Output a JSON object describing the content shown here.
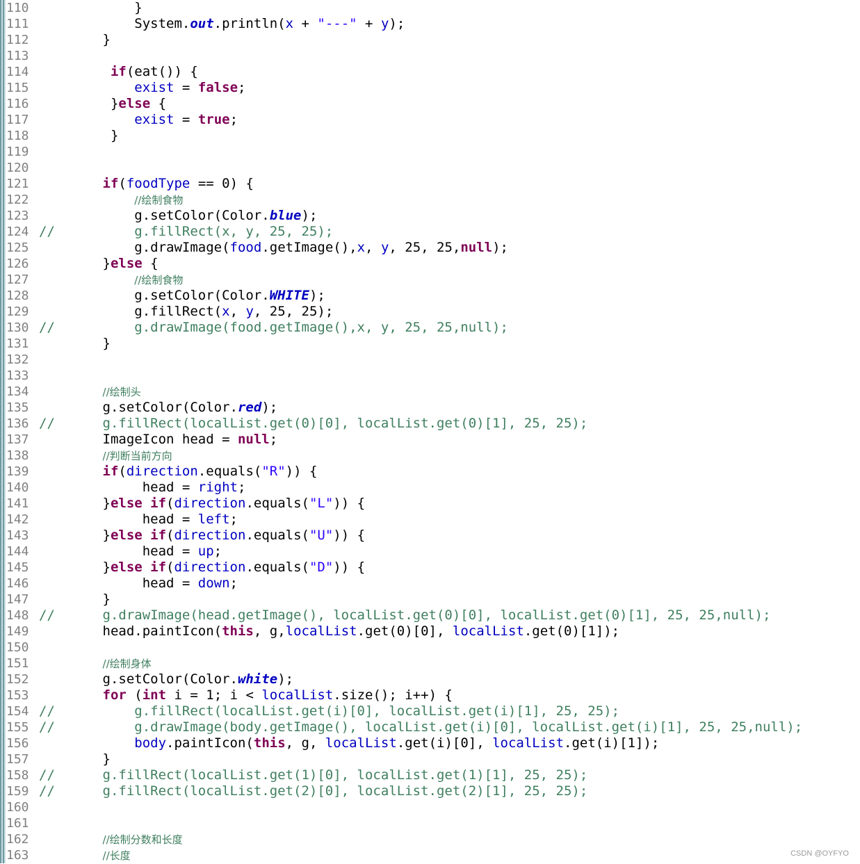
{
  "editor": {
    "colors": {
      "keyword": "#7f0055",
      "field": "#0000c0",
      "string": "#2a00ff",
      "comment": "#3f7f5f",
      "plain": "#000000",
      "line_number": "#808080"
    },
    "lines": [
      {
        "num": "110",
        "tokens": [
          {
            "t": "            }",
            "c": "plain"
          }
        ]
      },
      {
        "num": "111",
        "tokens": [
          {
            "t": "            System.",
            "c": "plain"
          },
          {
            "t": "out",
            "c": "sfield"
          },
          {
            "t": ".println(",
            "c": "plain"
          },
          {
            "t": "x",
            "c": "field"
          },
          {
            "t": " + ",
            "c": "plain"
          },
          {
            "t": "\"---\"",
            "c": "str"
          },
          {
            "t": " + ",
            "c": "plain"
          },
          {
            "t": "y",
            "c": "field"
          },
          {
            "t": ");",
            "c": "plain"
          }
        ]
      },
      {
        "num": "112",
        "tokens": [
          {
            "t": "        }",
            "c": "plain"
          }
        ]
      },
      {
        "num": "113",
        "tokens": []
      },
      {
        "num": "114",
        "tokens": [
          {
            "t": "         ",
            "c": "plain"
          },
          {
            "t": "if",
            "c": "kw"
          },
          {
            "t": "(eat()) {",
            "c": "plain"
          }
        ]
      },
      {
        "num": "115",
        "tokens": [
          {
            "t": "            ",
            "c": "plain"
          },
          {
            "t": "exist",
            "c": "field"
          },
          {
            "t": " = ",
            "c": "plain"
          },
          {
            "t": "false",
            "c": "kw"
          },
          {
            "t": ";",
            "c": "plain"
          }
        ]
      },
      {
        "num": "116",
        "tokens": [
          {
            "t": "         }",
            "c": "plain"
          },
          {
            "t": "else",
            "c": "kw"
          },
          {
            "t": " {",
            "c": "plain"
          }
        ]
      },
      {
        "num": "117",
        "tokens": [
          {
            "t": "            ",
            "c": "plain"
          },
          {
            "t": "exist",
            "c": "field"
          },
          {
            "t": " = ",
            "c": "plain"
          },
          {
            "t": "true",
            "c": "kw"
          },
          {
            "t": ";",
            "c": "plain"
          }
        ]
      },
      {
        "num": "118",
        "tokens": [
          {
            "t": "         }",
            "c": "plain"
          }
        ]
      },
      {
        "num": "119",
        "tokens": []
      },
      {
        "num": "120",
        "tokens": []
      },
      {
        "num": "121",
        "tokens": [
          {
            "t": "        ",
            "c": "plain"
          },
          {
            "t": "if",
            "c": "kw"
          },
          {
            "t": "(",
            "c": "plain"
          },
          {
            "t": "foodType",
            "c": "field"
          },
          {
            "t": " == 0) {",
            "c": "plain"
          }
        ]
      },
      {
        "num": "122",
        "tokens": [
          {
            "t": "            ",
            "c": "plain"
          },
          {
            "t": "//绘制食物",
            "c": "cmtzh"
          }
        ]
      },
      {
        "num": "123",
        "tokens": [
          {
            "t": "            g.setColor(Color.",
            "c": "plain"
          },
          {
            "t": "blue",
            "c": "sfield"
          },
          {
            "t": ");",
            "c": "plain"
          }
        ]
      },
      {
        "num": "124",
        "tokens": [
          {
            "t": "//          g.fillRect(x, y, 25, 25);",
            "c": "cmt"
          }
        ]
      },
      {
        "num": "125",
        "tokens": [
          {
            "t": "            g.drawImage(",
            "c": "plain"
          },
          {
            "t": "food",
            "c": "field"
          },
          {
            "t": ".getImage(),",
            "c": "plain"
          },
          {
            "t": "x",
            "c": "field"
          },
          {
            "t": ", ",
            "c": "plain"
          },
          {
            "t": "y",
            "c": "field"
          },
          {
            "t": ", 25, 25,",
            "c": "plain"
          },
          {
            "t": "null",
            "c": "kw"
          },
          {
            "t": ");",
            "c": "plain"
          }
        ]
      },
      {
        "num": "126",
        "tokens": [
          {
            "t": "        }",
            "c": "plain"
          },
          {
            "t": "else",
            "c": "kw"
          },
          {
            "t": " {",
            "c": "plain"
          }
        ]
      },
      {
        "num": "127",
        "tokens": [
          {
            "t": "            ",
            "c": "plain"
          },
          {
            "t": "//绘制食物",
            "c": "cmtzh"
          }
        ]
      },
      {
        "num": "128",
        "tokens": [
          {
            "t": "            g.setColor(Color.",
            "c": "plain"
          },
          {
            "t": "WHITE",
            "c": "sfield"
          },
          {
            "t": ");",
            "c": "plain"
          }
        ]
      },
      {
        "num": "129",
        "tokens": [
          {
            "t": "            g.fillRect(",
            "c": "plain"
          },
          {
            "t": "x",
            "c": "field"
          },
          {
            "t": ", ",
            "c": "plain"
          },
          {
            "t": "y",
            "c": "field"
          },
          {
            "t": ", 25, 25);",
            "c": "plain"
          }
        ]
      },
      {
        "num": "130",
        "tokens": [
          {
            "t": "//          g.drawImage(food.getImage(),x, y, 25, 25,null);",
            "c": "cmt"
          }
        ]
      },
      {
        "num": "131",
        "tokens": [
          {
            "t": "        }",
            "c": "plain"
          }
        ]
      },
      {
        "num": "132",
        "tokens": []
      },
      {
        "num": "133",
        "tokens": []
      },
      {
        "num": "134",
        "tokens": [
          {
            "t": "        ",
            "c": "plain"
          },
          {
            "t": "//绘制头",
            "c": "cmtzh"
          }
        ]
      },
      {
        "num": "135",
        "tokens": [
          {
            "t": "        g.setColor(Color.",
            "c": "plain"
          },
          {
            "t": "red",
            "c": "sfield"
          },
          {
            "t": ");",
            "c": "plain"
          }
        ]
      },
      {
        "num": "136",
        "tokens": [
          {
            "t": "//      g.fillRect(localList.get(0)[0], localList.get(0)[1], 25, 25);",
            "c": "cmt"
          }
        ]
      },
      {
        "num": "137",
        "tokens": [
          {
            "t": "        ImageIcon head = ",
            "c": "plain"
          },
          {
            "t": "null",
            "c": "kw"
          },
          {
            "t": ";",
            "c": "plain"
          }
        ]
      },
      {
        "num": "138",
        "tokens": [
          {
            "t": "        ",
            "c": "plain"
          },
          {
            "t": "//判断当前方向",
            "c": "cmtzh"
          }
        ]
      },
      {
        "num": "139",
        "tokens": [
          {
            "t": "        ",
            "c": "plain"
          },
          {
            "t": "if",
            "c": "kw"
          },
          {
            "t": "(",
            "c": "plain"
          },
          {
            "t": "direction",
            "c": "field"
          },
          {
            "t": ".equals(",
            "c": "plain"
          },
          {
            "t": "\"R\"",
            "c": "str"
          },
          {
            "t": ")) {",
            "c": "plain"
          }
        ]
      },
      {
        "num": "140",
        "tokens": [
          {
            "t": "             head = ",
            "c": "plain"
          },
          {
            "t": "right",
            "c": "field"
          },
          {
            "t": ";",
            "c": "plain"
          }
        ]
      },
      {
        "num": "141",
        "tokens": [
          {
            "t": "        }",
            "c": "plain"
          },
          {
            "t": "else if",
            "c": "kw"
          },
          {
            "t": "(",
            "c": "plain"
          },
          {
            "t": "direction",
            "c": "field"
          },
          {
            "t": ".equals(",
            "c": "plain"
          },
          {
            "t": "\"L\"",
            "c": "str"
          },
          {
            "t": ")) {",
            "c": "plain"
          }
        ]
      },
      {
        "num": "142",
        "tokens": [
          {
            "t": "             head = ",
            "c": "plain"
          },
          {
            "t": "left",
            "c": "field"
          },
          {
            "t": ";",
            "c": "plain"
          }
        ]
      },
      {
        "num": "143",
        "tokens": [
          {
            "t": "        }",
            "c": "plain"
          },
          {
            "t": "else if",
            "c": "kw"
          },
          {
            "t": "(",
            "c": "plain"
          },
          {
            "t": "direction",
            "c": "field"
          },
          {
            "t": ".equals(",
            "c": "plain"
          },
          {
            "t": "\"U\"",
            "c": "str"
          },
          {
            "t": ")) {",
            "c": "plain"
          }
        ]
      },
      {
        "num": "144",
        "tokens": [
          {
            "t": "             head = ",
            "c": "plain"
          },
          {
            "t": "up",
            "c": "field"
          },
          {
            "t": ";",
            "c": "plain"
          }
        ]
      },
      {
        "num": "145",
        "tokens": [
          {
            "t": "        }",
            "c": "plain"
          },
          {
            "t": "else if",
            "c": "kw"
          },
          {
            "t": "(",
            "c": "plain"
          },
          {
            "t": "direction",
            "c": "field"
          },
          {
            "t": ".equals(",
            "c": "plain"
          },
          {
            "t": "\"D\"",
            "c": "str"
          },
          {
            "t": ")) {",
            "c": "plain"
          }
        ]
      },
      {
        "num": "146",
        "tokens": [
          {
            "t": "             head = ",
            "c": "plain"
          },
          {
            "t": "down",
            "c": "field"
          },
          {
            "t": ";",
            "c": "plain"
          }
        ]
      },
      {
        "num": "147",
        "tokens": [
          {
            "t": "        }",
            "c": "plain"
          }
        ]
      },
      {
        "num": "148",
        "tokens": [
          {
            "t": "//      g.drawImage(head.getImage(), localList.get(0)[0], localList.get(0)[1], 25, 25,null);",
            "c": "cmt"
          }
        ]
      },
      {
        "num": "149",
        "tokens": [
          {
            "t": "        head.paintIcon(",
            "c": "plain"
          },
          {
            "t": "this",
            "c": "kw"
          },
          {
            "t": ", g,",
            "c": "plain"
          },
          {
            "t": "localList",
            "c": "field"
          },
          {
            "t": ".get(0)[0], ",
            "c": "plain"
          },
          {
            "t": "localList",
            "c": "field"
          },
          {
            "t": ".get(0)[1]);",
            "c": "plain"
          }
        ]
      },
      {
        "num": "150",
        "tokens": []
      },
      {
        "num": "151",
        "tokens": [
          {
            "t": "        ",
            "c": "plain"
          },
          {
            "t": "//绘制身体",
            "c": "cmtzh"
          }
        ]
      },
      {
        "num": "152",
        "tokens": [
          {
            "t": "        g.setColor(Color.",
            "c": "plain"
          },
          {
            "t": "white",
            "c": "sfield"
          },
          {
            "t": ");",
            "c": "plain"
          }
        ]
      },
      {
        "num": "153",
        "tokens": [
          {
            "t": "        ",
            "c": "plain"
          },
          {
            "t": "for",
            "c": "kw"
          },
          {
            "t": " (",
            "c": "plain"
          },
          {
            "t": "int",
            "c": "kw"
          },
          {
            "t": " i = 1; i < ",
            "c": "plain"
          },
          {
            "t": "localList",
            "c": "field"
          },
          {
            "t": ".size(); i++) {",
            "c": "plain"
          }
        ]
      },
      {
        "num": "154",
        "tokens": [
          {
            "t": "//          g.fillRect(localList.get(i)[0], localList.get(i)[1], 25, 25);",
            "c": "cmt"
          }
        ]
      },
      {
        "num": "155",
        "tokens": [
          {
            "t": "//          g.drawImage(body.getImage(), localList.get(i)[0], localList.get(i)[1], 25, 25,null);",
            "c": "cmt"
          }
        ]
      },
      {
        "num": "156",
        "tokens": [
          {
            "t": "            ",
            "c": "plain"
          },
          {
            "t": "body",
            "c": "field"
          },
          {
            "t": ".paintIcon(",
            "c": "plain"
          },
          {
            "t": "this",
            "c": "kw"
          },
          {
            "t": ", g, ",
            "c": "plain"
          },
          {
            "t": "localList",
            "c": "field"
          },
          {
            "t": ".get(i)[0], ",
            "c": "plain"
          },
          {
            "t": "localList",
            "c": "field"
          },
          {
            "t": ".get(i)[1]);",
            "c": "plain"
          }
        ]
      },
      {
        "num": "157",
        "tokens": [
          {
            "t": "        }",
            "c": "plain"
          }
        ]
      },
      {
        "num": "158",
        "tokens": [
          {
            "t": "//      g.fillRect(localList.get(1)[0], localList.get(1)[1], 25, 25);",
            "c": "cmt"
          }
        ]
      },
      {
        "num": "159",
        "tokens": [
          {
            "t": "//      g.fillRect(localList.get(2)[0], localList.get(2)[1], 25, 25);",
            "c": "cmt"
          }
        ]
      },
      {
        "num": "160",
        "tokens": []
      },
      {
        "num": "161",
        "tokens": []
      },
      {
        "num": "162",
        "tokens": [
          {
            "t": "        ",
            "c": "plain"
          },
          {
            "t": "//绘制分数和长度",
            "c": "cmtzh"
          }
        ]
      },
      {
        "num": "163",
        "tokens": [
          {
            "t": "        ",
            "c": "plain"
          },
          {
            "t": "//长度",
            "c": "cmtzh"
          }
        ]
      }
    ]
  },
  "watermark": "CSDN @OYFYO"
}
